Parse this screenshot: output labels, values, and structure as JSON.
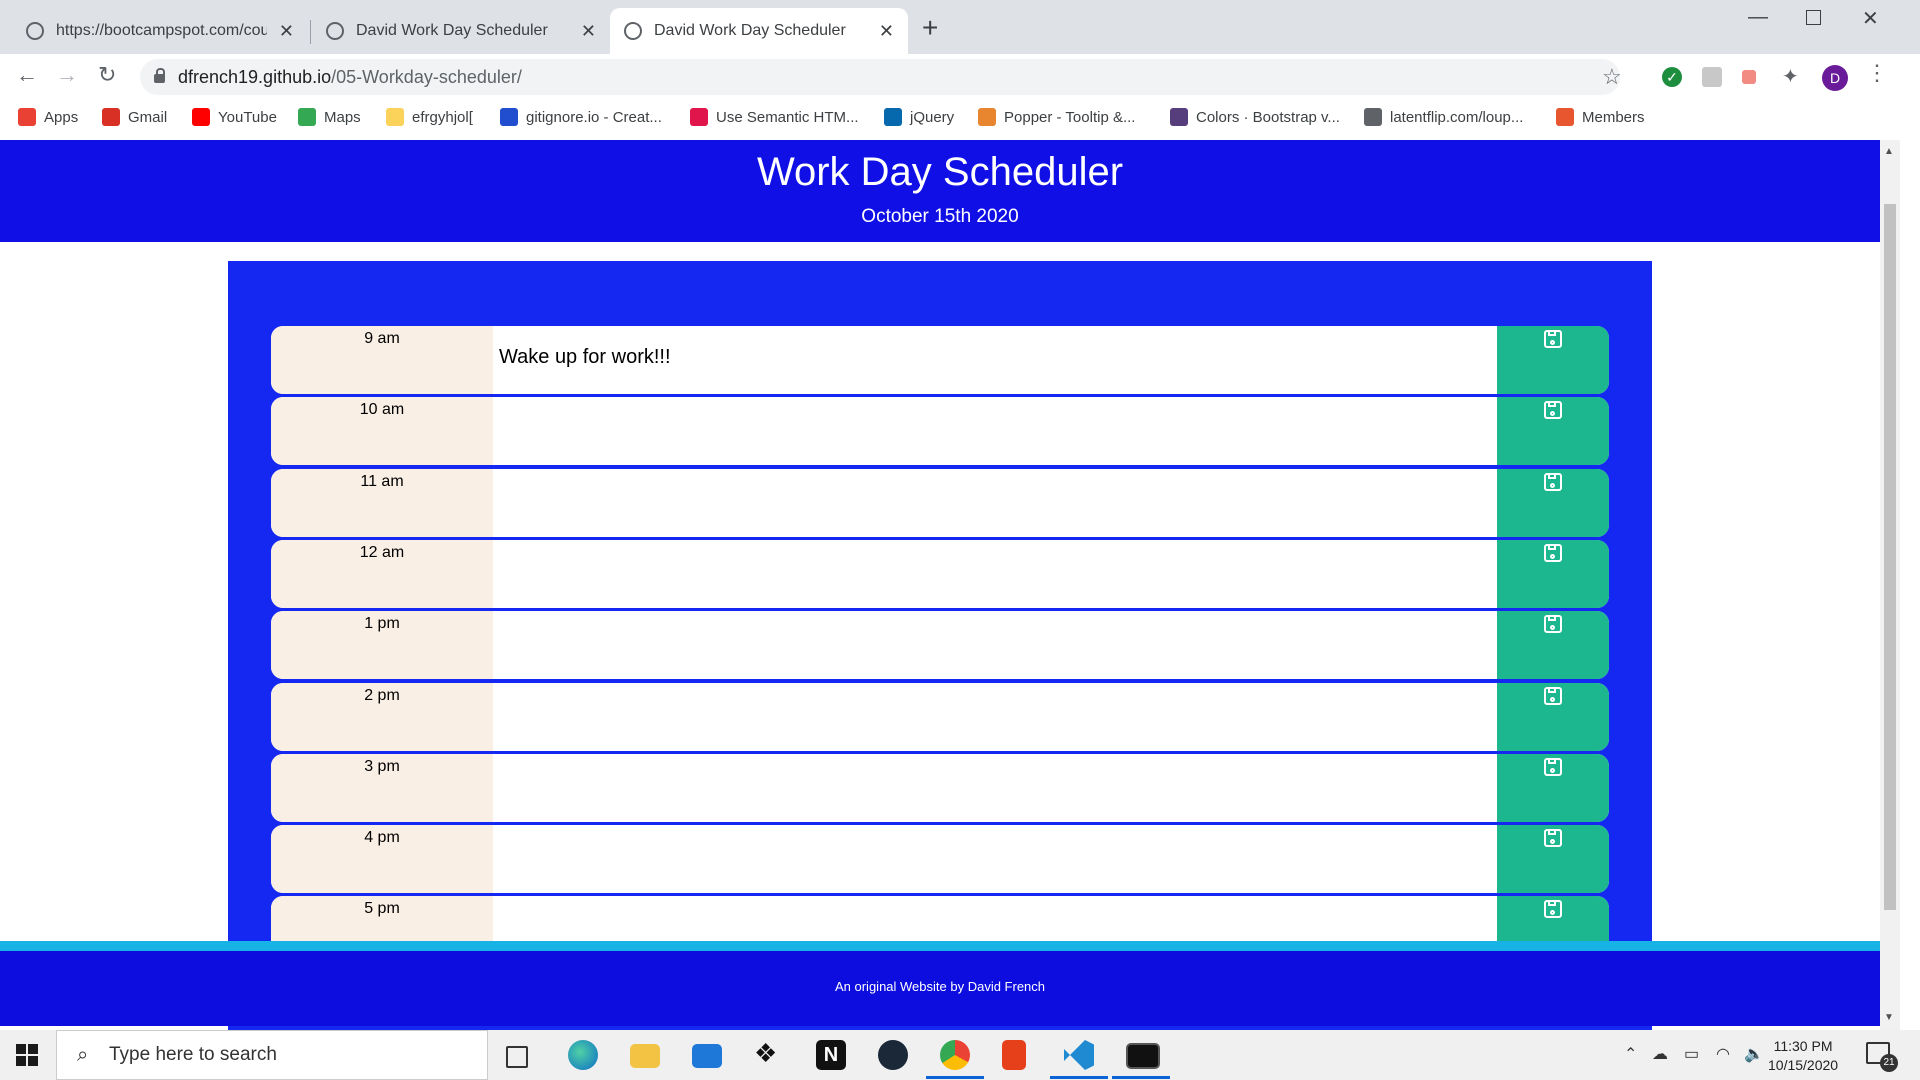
{
  "browser": {
    "tabs": [
      {
        "title": "https://bootcampspot.com/cours",
        "active": false
      },
      {
        "title": "David Work Day Scheduler",
        "active": false
      },
      {
        "title": "David Work Day Scheduler",
        "active": true
      }
    ],
    "url_host": "dfrench19.github.io",
    "url_path": "/05-Workday-scheduler/",
    "profile_initial": "D",
    "bookmarks": [
      {
        "label": "Apps",
        "icon": "apps-grid-icon",
        "color": "#e94235"
      },
      {
        "label": "Gmail",
        "icon": "gmail-icon",
        "color": "#d93025"
      },
      {
        "label": "YouTube",
        "icon": "youtube-icon",
        "color": "#ff0000"
      },
      {
        "label": "Maps",
        "icon": "maps-icon",
        "color": "#34a853"
      },
      {
        "label": "efrgyhjol[",
        "icon": "folder-icon",
        "color": "#fbd35b"
      },
      {
        "label": "gitignore.io - Creat...",
        "icon": "gitignore-icon",
        "color": "#204ecf"
      },
      {
        "label": "Use Semantic HTM...",
        "icon": "semantic-icon",
        "color": "#e0154b"
      },
      {
        "label": "jQuery",
        "icon": "jquery-icon",
        "color": "#0769ad"
      },
      {
        "label": "Popper - Tooltip &...",
        "icon": "popper-icon",
        "color": "#e8862f"
      },
      {
        "label": "Colors · Bootstrap v...",
        "icon": "bootstrap-icon",
        "color": "#563d7c"
      },
      {
        "label": "latentflip.com/loup...",
        "icon": "globe-icon",
        "color": "#5f6368"
      },
      {
        "label": "Members",
        "icon": "members-icon",
        "color": "#e8562f"
      }
    ]
  },
  "page": {
    "title": "Work Day Scheduler",
    "date": "October 15th 2020",
    "rows": [
      {
        "hour": "9 am",
        "text": "Wake up for work!!!"
      },
      {
        "hour": "10 am",
        "text": ""
      },
      {
        "hour": "11 am",
        "text": ""
      },
      {
        "hour": "12 am",
        "text": ""
      },
      {
        "hour": "1 pm",
        "text": ""
      },
      {
        "hour": "2 pm",
        "text": ""
      },
      {
        "hour": "3 pm",
        "text": ""
      },
      {
        "hour": "4 pm",
        "text": ""
      },
      {
        "hour": "5 pm",
        "text": ""
      }
    ],
    "footer": "An original Website by David French",
    "colors": {
      "header": "#1010e6",
      "container": "#1428f2",
      "hour_bg": "#faefe4",
      "save_bg": "#1cb68f",
      "footer": "#0d0de0",
      "footer_line": "#17b3e6"
    }
  },
  "taskbar": {
    "search_placeholder": "Type here to search",
    "time": "11:30 PM",
    "date": "10/15/2020",
    "notification_count": "21"
  }
}
